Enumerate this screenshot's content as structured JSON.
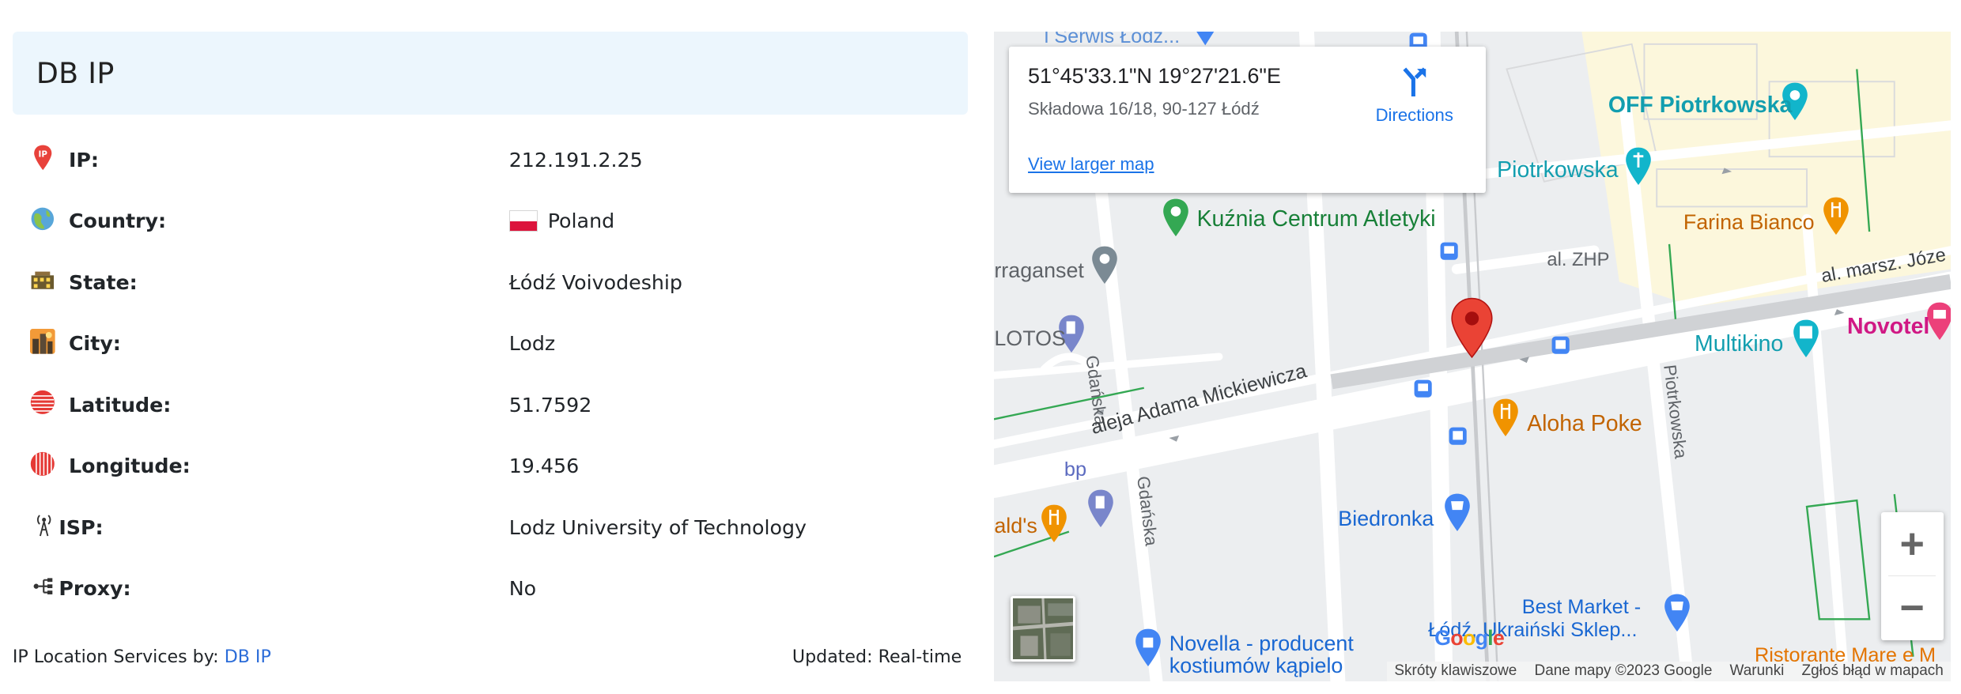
{
  "card": {
    "title": "DB IP",
    "rows": [
      {
        "label": "IP:",
        "value": "212.191.2.25",
        "icon": "ip-pin-icon"
      },
      {
        "label": "Country:",
        "value": "Poland",
        "icon": "globe-icon"
      },
      {
        "label": "State:",
        "value": "Łódź Voivodeship",
        "icon": "state-icon"
      },
      {
        "label": "City:",
        "value": "Lodz",
        "icon": "city-icon"
      },
      {
        "label": "Latitude:",
        "value": "51.7592",
        "icon": "latitude-icon"
      },
      {
        "label": "Longitude:",
        "value": "19.456",
        "icon": "longitude-icon"
      },
      {
        "label": "ISP:",
        "value": "Lodz University of Technology",
        "icon": "antenna-icon"
      },
      {
        "label": "Proxy:",
        "value": "No",
        "icon": "proxy-icon"
      }
    ],
    "footer_prefix": "IP Location Services by:",
    "footer_link": "DB IP",
    "updated": "Updated: Real-time"
  },
  "map": {
    "coords": "51°45'33.1\"N 19°27'21.6\"E",
    "address": "Składowa 16/18, 90-127 Łódź",
    "directions": "Directions",
    "view_larger": "View larger map",
    "labels": {
      "serwis": "l Serwis Łodz...",
      "off_piotrkowska": "OFF Piotrkowska",
      "piotrkowska_top": "Piotrkowska",
      "kuznia": "Kuźnia Centrum Atletyki",
      "farina": "Farina Bianco",
      "narraganset": "rraganset",
      "al_zhp": "al. ZHP",
      "al_marsz": "al. marsz. Józe",
      "lotos": "LOTOS",
      "gdanska_top": "Gdańska",
      "multikino": "Multikino",
      "novotel": "Novotel",
      "mickiewicza": "aleja Adama Mickiewicza",
      "aloha": "Aloha Poke",
      "piotrkowska_street": "Piotrkowska",
      "bp": "bp",
      "gdanska_bottom": "Gdańska",
      "alds": "ald's",
      "biedronka": "Biedronka",
      "best_market_1": "Best Market -",
      "best_market_2": "Łódź, Ukraiński Sklep...",
      "novella_1": "Novella - producent",
      "novella_2": "kostiumów kąpielo",
      "ristorante": "Ristorante Mare e M"
    },
    "zoom_in": "+",
    "zoom_out": "−",
    "google": "Google",
    "attribution": [
      "Skróty klawiszowe",
      "Dane mapy ©2023 Google",
      "Warunki",
      "Zgłoś błąd w mapach"
    ]
  },
  "colors": {
    "header_bg": "#ecf6fd",
    "link": "#1a73e8",
    "pin_red": "#ea4335",
    "poi_green": "#188038",
    "poi_orange": "#e37400",
    "poi_teal": "#129eaf",
    "poi_blue": "#4285f4"
  }
}
